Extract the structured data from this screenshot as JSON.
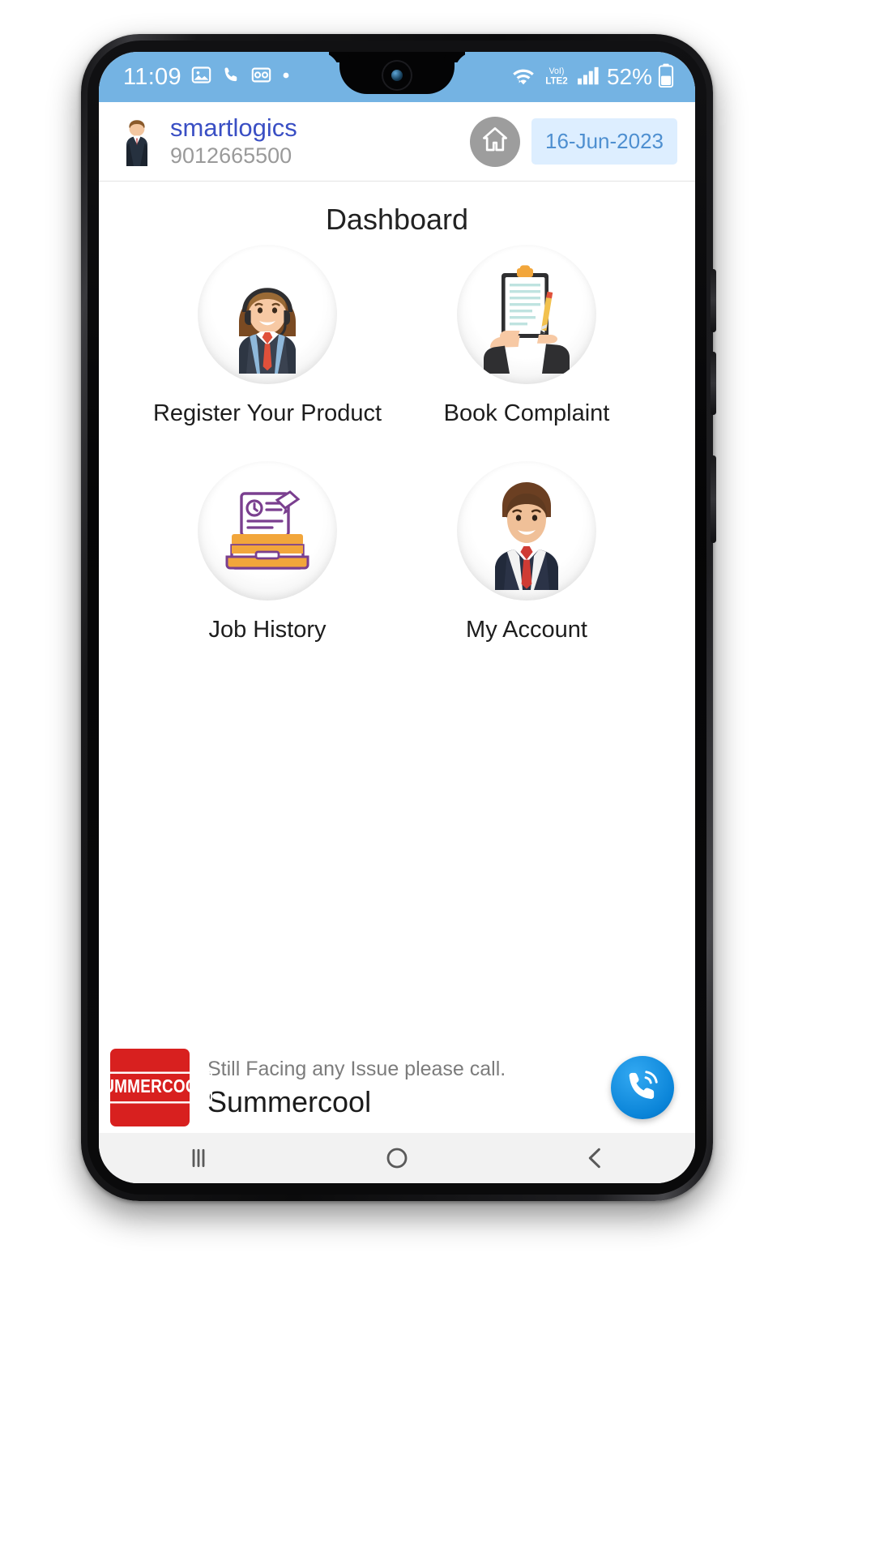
{
  "status_bar": {
    "time": "11:09",
    "battery_percent": "52%",
    "icons": [
      "image-icon",
      "phone-call-icon",
      "voicemail-icon",
      "dot-icon",
      "wifi-icon",
      "volte-icon",
      "signal-bars-icon",
      "battery-icon"
    ],
    "network_label_top": "VoI)",
    "network_label_bottom": "LTE2",
    "background_color": "#74b3e3"
  },
  "header": {
    "user_name": "smartlogics",
    "user_phone": "9012665500",
    "home_button_label": "home-icon",
    "date": "16-Jun-2023",
    "date_pill_bg": "#ddeeff",
    "date_pill_color": "#4e8fd0",
    "name_color": "#3a4fc4"
  },
  "page": {
    "title": "Dashboard"
  },
  "dashboard": {
    "tiles": [
      {
        "label": "Register Your Product",
        "icon": "support-agent-headset-icon"
      },
      {
        "label": "Book Complaint",
        "icon": "clipboard-pencil-icon"
      },
      {
        "label": "Job History",
        "icon": "archive-document-icon"
      },
      {
        "label": "My Account",
        "icon": "businessman-avatar-icon"
      }
    ]
  },
  "banner": {
    "logo_text": "SUMMERCOOL",
    "logo_bg": "#d8201f",
    "subtitle": "Still Facing any Issue please call.",
    "title": "Summercool",
    "call_button": "phone-call-icon",
    "call_button_color": "#0a84d8"
  },
  "navigation_bar": {
    "items": [
      {
        "name": "recent-apps-button",
        "glyph": "|||"
      },
      {
        "name": "home-button",
        "glyph": "○"
      },
      {
        "name": "back-button",
        "glyph": "‹"
      }
    ]
  }
}
